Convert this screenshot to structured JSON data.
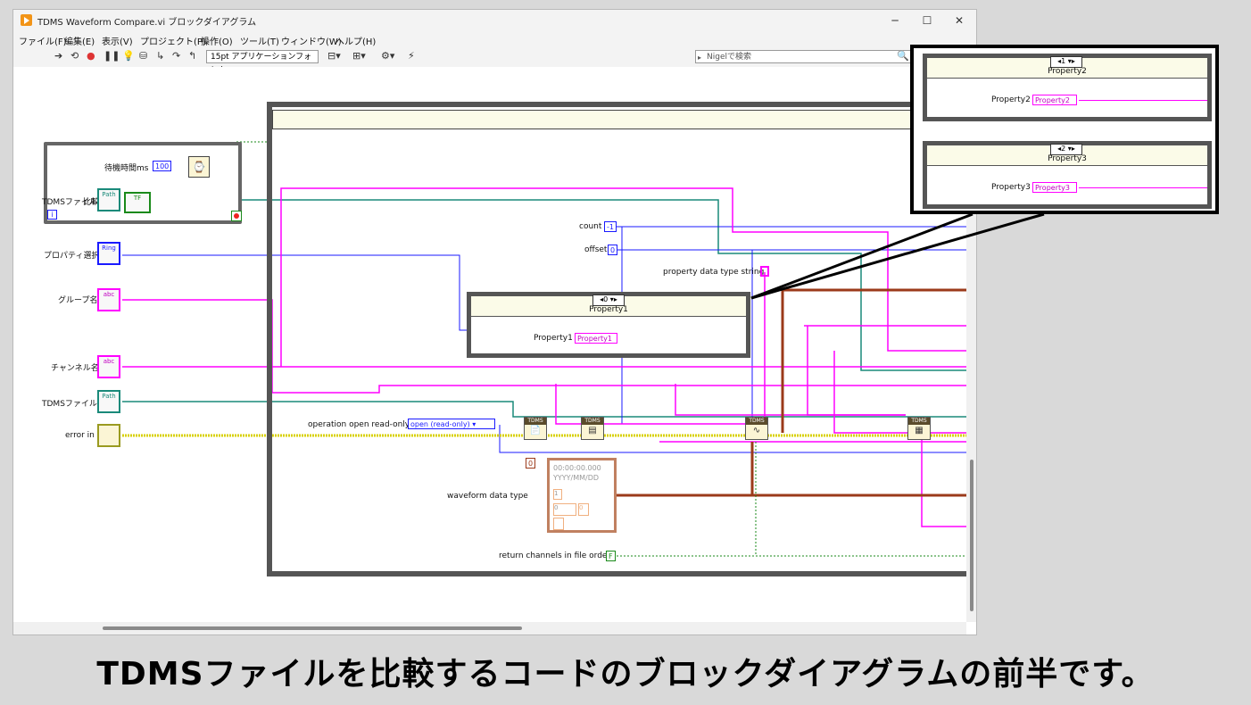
{
  "window": {
    "title": "TDMS Waveform Compare.vi ブロックダイアグラム",
    "controls": [
      "─",
      "☐",
      "✕"
    ]
  },
  "menu": [
    "ファイル(F)",
    "編集(E)",
    "表示(V)",
    "プロジェクト(P)",
    "操作(O)",
    "ツール(T)",
    "ウィンドウ(W)",
    "ヘルプ(H)"
  ],
  "toolbar": {
    "font_select": "15pt アプリケーションフォント",
    "search_placeholder": "Nigelで検索",
    "icons": [
      "run-arrow-icon",
      "run-continuous-icon",
      "abort-icon",
      "pause-icon",
      "highlight-execution-icon",
      "retain-wire-values-icon",
      "step-into-icon",
      "step-over-icon",
      "step-out-icon",
      "align-icon",
      "distribute-icon",
      "reorder-icon",
      "cleanup-icon"
    ]
  },
  "loop_panel": {
    "wait_label": "待機時間ms",
    "wait_value": "100",
    "compare_label": "比較実行",
    "compare_tag": "TF",
    "info_glyph": "i"
  },
  "controls_left": [
    {
      "label": "TDMSファイル2",
      "tag": "Path"
    },
    {
      "label": "プロパティ選択",
      "tag": "Ring"
    },
    {
      "label": "グループ名",
      "tag": "abc"
    },
    {
      "label": "チャンネル名",
      "tag": "abc"
    },
    {
      "label": "TDMSファイル1",
      "tag": "Path"
    },
    {
      "label": "error in",
      "tag": ""
    }
  ],
  "constants": {
    "count_label": "count",
    "count_value": "-1",
    "offset_label": "offset",
    "offset_value": "0",
    "prop_type_label": "property data type string",
    "operation_label": "operation open read-only",
    "operation_value": "open (read-only)",
    "waveform_label": "waveform data type",
    "timestamp": "00:00:00.000",
    "date": "YYYY/MM/DD",
    "wf_index": "0",
    "wf_dt": "1",
    "wf_y0": "0",
    "wf_y1": "0",
    "return_label": "return channels in file order",
    "return_value": "F"
  },
  "case_main": {
    "selector": "0",
    "title": "Property1",
    "row_label": "Property1",
    "row_value": "Property1"
  },
  "zoom_cases": [
    {
      "selector": "1",
      "title": "Property2",
      "row_label": "Property2",
      "row_value": "Property2"
    },
    {
      "selector": "2",
      "title": "Property3",
      "row_label": "Property3",
      "row_value": "Property3"
    }
  ],
  "tdms_nodes": [
    "TDMS",
    "TDMS",
    "TDMS",
    "TDMS"
  ],
  "caption": "TDMSファイルを比較するコードのブロックダイアグラムの前半です。",
  "colors": {
    "pink": "#ff00ff",
    "teal": "#1a8a7a",
    "blue": "#1a1aff",
    "yellow": "#d8d000",
    "brown": "#9b3a1a",
    "green": "#1a8a1a"
  }
}
